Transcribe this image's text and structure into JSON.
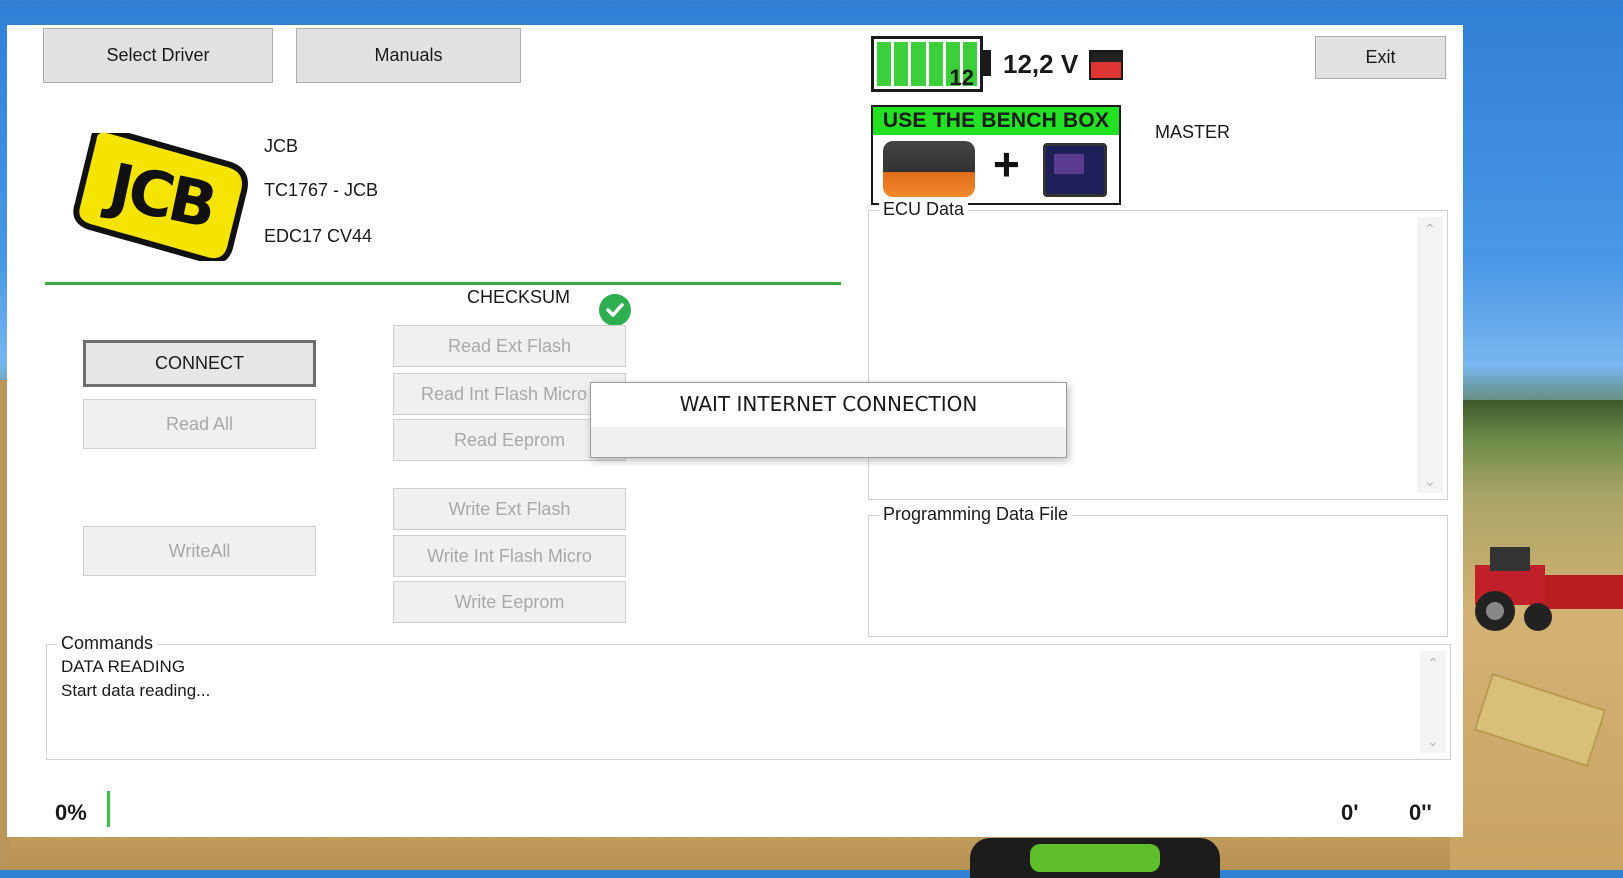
{
  "toolbar": {
    "select_driver": "Select Driver",
    "manuals": "Manuals",
    "exit": "Exit"
  },
  "vehicle": {
    "logo_text": "JCB",
    "brand": "JCB",
    "model": "TC1767 - JCB",
    "ecu": "EDC17 CV44"
  },
  "battery": {
    "level_label": "12",
    "voltage": "12,2 V"
  },
  "bench": {
    "title": "USE THE BENCH BOX"
  },
  "mode": "MASTER",
  "checksum_label": "CHECKSUM",
  "actions": {
    "connect": "CONNECT",
    "read_all": "Read All",
    "write_all": "WriteAll",
    "read_ext_flash": "Read Ext Flash",
    "read_int_flash": "Read Int Flash Micro",
    "read_eeprom": "Read Eeprom",
    "write_ext_flash": "Write Ext Flash",
    "write_int_flash": "Write Int Flash Micro",
    "write_eeprom": "Write Eeprom"
  },
  "panels": {
    "ecu_data": "ECU Data",
    "programming_file": "Programming Data File",
    "commands": "Commands"
  },
  "commands_log": [
    "DATA READING",
    "Start data reading..."
  ],
  "popup": {
    "message": "WAIT INTERNET CONNECTION"
  },
  "status": {
    "progress": "0%",
    "minutes": "0'",
    "seconds": "0''"
  },
  "colors": {
    "accent_green": "#39a844",
    "bench_header": "#22e022",
    "logo_yellow": "#f5e400"
  }
}
